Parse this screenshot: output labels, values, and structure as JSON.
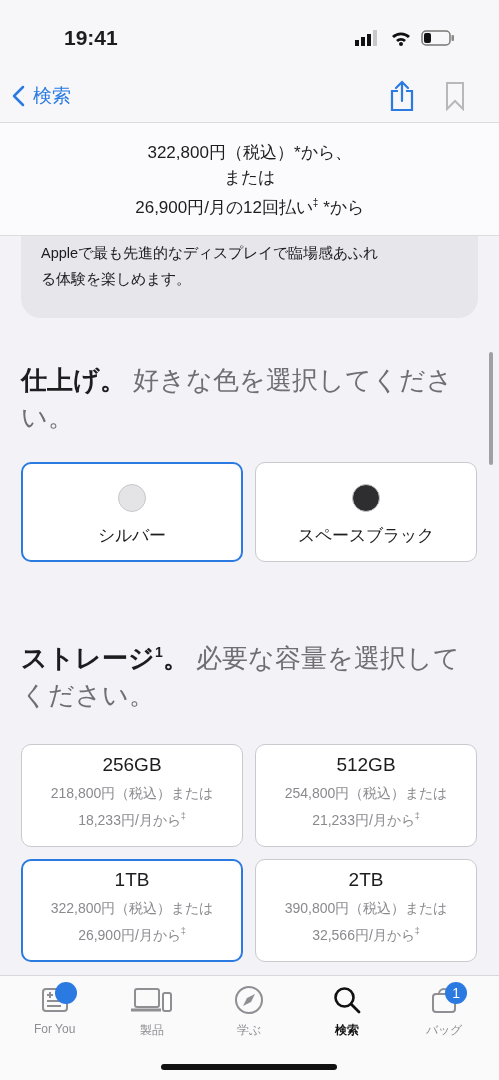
{
  "status_bar": {
    "time": "19:41"
  },
  "nav_bar": {
    "back_label": "検索"
  },
  "price_header": {
    "lines": [
      "322,800円（税込）*から、",
      "または",
      "26,900円/月の12回払い$^{‡}$ *から"
    ]
  },
  "description": {
    "text": "Appleで最も先進的なディスプレイで臨場感あふれる体験を楽しめます。"
  },
  "finish": {
    "heading": "**仕上げ。** 好きな色を選択してください。",
    "options": [
      {
        "name": "シルバー",
        "color": "#e4e4e6",
        "selected": true
      },
      {
        "name": "スペースブラック",
        "color": "#2e2e30",
        "selected": false
      }
    ]
  },
  "storage": {
    "heading": "**ストレージ**$^{1}$**。** 必要な容量を選択してください。",
    "options": [
      {
        "capacity": "256GB",
        "price": "218,800円（税込）または",
        "monthly": "18,233円/月から$^{‡}$",
        "selected": false
      },
      {
        "capacity": "512GB",
        "price": "254,800円（税込）または",
        "monthly": "21,233円/月から$^{‡}$",
        "selected": false
      },
      {
        "capacity": "1TB",
        "price": "322,800円（税込）または",
        "monthly": "26,900円/月から$^{‡}$",
        "selected": true
      },
      {
        "capacity": "2TB",
        "price": "390,800円（税込）または",
        "monthly": "32,566円/月から$^{‡}$",
        "selected": false
      }
    ]
  },
  "tab_bar": {
    "items": [
      {
        "label": "For You",
        "selected": false,
        "notification_dot": true
      },
      {
        "label": "製品",
        "selected": false,
        "notification_dot": false
      },
      {
        "label": "学ぶ",
        "selected": false,
        "notification_dot": false
      },
      {
        "label": "検索",
        "selected": true,
        "notification_dot": false
      },
      {
        "label": "バッグ",
        "selected": false,
        "notification_dot": false,
        "badge": "1"
      }
    ]
  }
}
